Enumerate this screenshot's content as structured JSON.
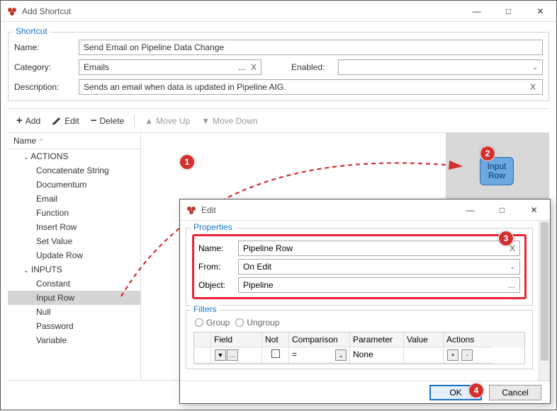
{
  "window": {
    "title": "Add Shortcut",
    "min": "—",
    "max": "□",
    "close": "✕"
  },
  "shortcut": {
    "legend": "Shortcut",
    "name_label": "Name:",
    "name_value": "Send Email on Pipeline Data Change",
    "category_label": "Category:",
    "category_value": "Emails",
    "category_dots": "...",
    "category_clear": "X",
    "enabled_label": "Enabled:",
    "enabled_value": "",
    "description_label": "Description:",
    "description_value": "Sends an email when data is updated in Pipeline AIG.",
    "description_clear": "X"
  },
  "toolbar": {
    "add": "Add",
    "edit": "Edit",
    "delete": "Delete",
    "moveup": "Move Up",
    "movedown": "Move Down"
  },
  "tree": {
    "header": "Name",
    "header_arrow": "⌃",
    "groups": [
      {
        "label": "ACTIONS",
        "items": [
          "Concatenate String",
          "Documentum",
          "Email",
          "Function",
          "Insert Row",
          "Set Value",
          "Update Row"
        ]
      },
      {
        "label": "INPUTS",
        "items": [
          "Constant",
          "Input Row",
          "Null",
          "Password",
          "Variable"
        ]
      }
    ],
    "selected": "Input Row"
  },
  "node": {
    "label": "Input Row"
  },
  "badges": {
    "b1": "1",
    "b2": "2",
    "b3": "3",
    "b4": "4"
  },
  "dialog": {
    "title": "Edit",
    "min": "—",
    "max": "□",
    "close": "✕",
    "properties_legend": "Properties",
    "name_label": "Name:",
    "name_value": "Pipeline Row",
    "name_clear": "X",
    "from_label": "From:",
    "from_value": "On Edit",
    "object_label": "Object:",
    "object_value": "Pipeline",
    "object_dots": "...",
    "filters_legend": "Filters",
    "group_btn": "Group",
    "ungroup_btn": "Ungroup",
    "th_field": "Field",
    "th_not": "Not",
    "th_comp": "Comparison",
    "th_param": "Parameter",
    "th_value": "Value",
    "th_actions": "Actions",
    "row_comp": "=",
    "row_param": "None",
    "row_plus": "+",
    "row_minus": "-",
    "ok": "OK",
    "cancel": "Cancel"
  }
}
